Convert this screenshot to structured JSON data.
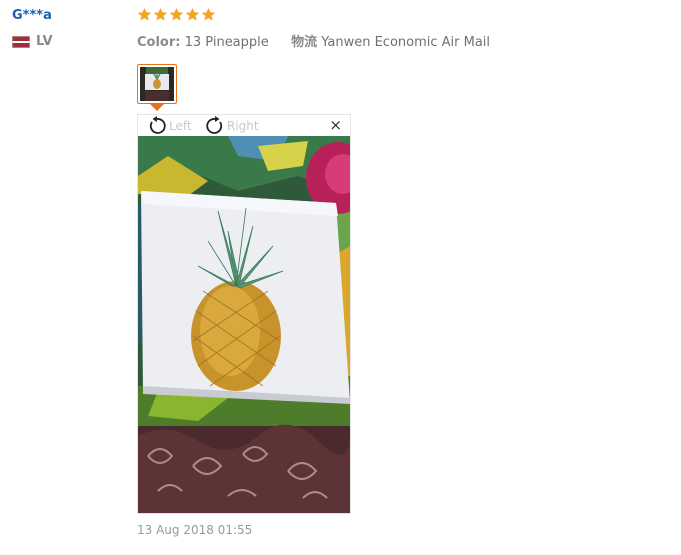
{
  "reviewer": {
    "name": "G***a",
    "country_code": "LV",
    "flag_icon": "flag-latvia-icon"
  },
  "rating": {
    "stars": 5,
    "max": 5,
    "color": "#f5a623"
  },
  "details": {
    "color_label": "Color:",
    "color_value": "13 Pineapple",
    "shipping_label": "物流",
    "shipping_value": "Yanwen Economic Air Mail"
  },
  "viewer": {
    "rotate_left_label": "Left",
    "rotate_right_label": "Right",
    "close_glyph": "×"
  },
  "date": "13 Aug 2018 01:55",
  "colors": {
    "name_link": "#1a5fb4",
    "thumb_border": "#e8721a",
    "star": "#f5a623"
  }
}
